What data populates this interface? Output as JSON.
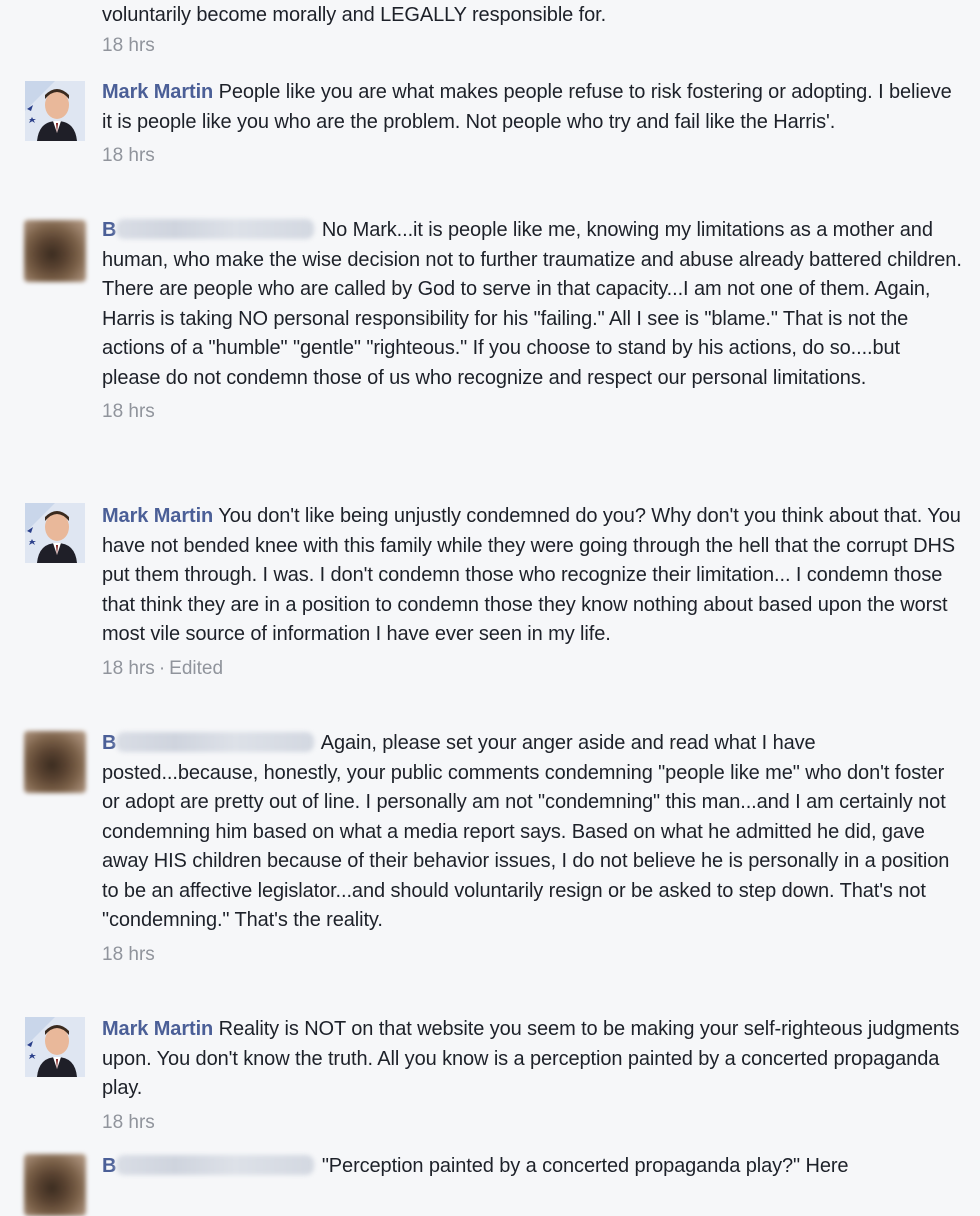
{
  "comments": [
    {
      "author": "",
      "text": "voluntarily become morally and LEGALLY responsible for.",
      "time": "18 hrs",
      "edited": ""
    },
    {
      "author": "Mark Martin",
      "text": "People like you are what makes people refuse to risk fostering or adopting. I believe it is people like you who are the problem. Not people who try and fail like the Harris'.",
      "time": "18 hrs",
      "edited": ""
    },
    {
      "author": "B",
      "text": "No Mark...it is people like me, knowing my limitations as a mother and human, who make the wise decision not to further traumatize and abuse already battered children. There are people who are called by God to serve in that capacity...I am not one of them. Again, Harris is taking NO personal responsibility for his \"failing.\" All I see is \"blame.\" That is not the actions of a \"humble\" \"gentle\" \"righteous.\" If you choose to stand by his actions, do so....but please do not condemn those of us who recognize and respect our personal limitations.",
      "time": "18 hrs",
      "edited": ""
    },
    {
      "author": "Mark Martin",
      "text": "You don't like being unjustly condemned do you? Why don't you think about that. You have not bended knee with this family while they were going through the hell that the corrupt DHS put them through. I was. I don't condemn those who recognize their limitation... I condemn those that think they are in a position to condemn those they know nothing about based upon the worst most vile source of information I have ever seen in my life.",
      "time": "18 hrs",
      "edited": "Edited"
    },
    {
      "author": "B",
      "text": "Again, please set your anger aside and read what I have posted...because, honestly, your public comments condemning \"people like me\" who don't foster or adopt are pretty out of line. I personally am not \"condemning\" this man...and I am certainly not condemning him based on what a media report says. Based on what he admitted he did, gave away HIS children because of their behavior issues, I do not believe he is personally in a position to be an affective legislator...and should voluntarily resign or be asked to step down. That's not \"condemning.\" That's the reality.",
      "time": "18 hrs",
      "edited": ""
    },
    {
      "author": "Mark Martin",
      "text": "Reality is NOT on that website you seem to be making your self-righteous judgments upon. You don't know the truth. All you know is a perception painted by a concerted propaganda play.",
      "time": "18 hrs",
      "edited": ""
    },
    {
      "author": "B",
      "text": "\"Perception painted by a concerted propaganda play?\" Here",
      "time": "",
      "edited": ""
    }
  ]
}
